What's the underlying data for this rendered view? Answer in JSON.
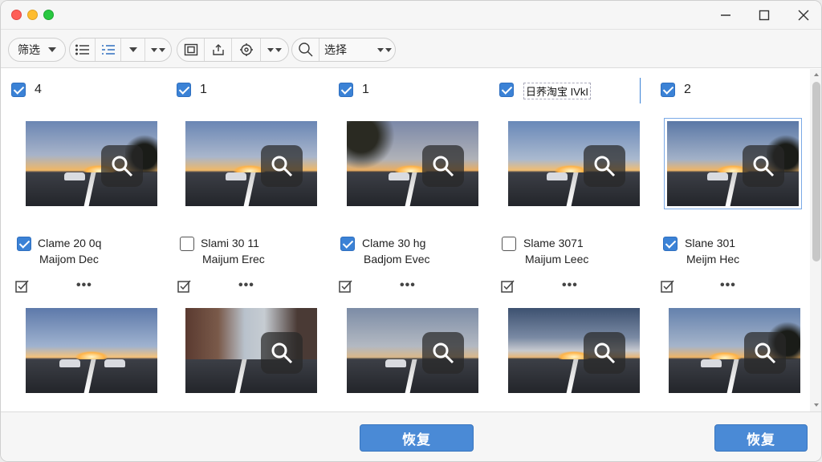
{
  "toolbar": {
    "filter_label": "筛选",
    "select_label": "选择"
  },
  "items": [
    {
      "count": "4",
      "caption_line1": "Clame 20 0q",
      "caption_line2": "Maijom Dec",
      "checked": true
    },
    {
      "count": "1",
      "caption_line1": "Slami 30 11",
      "caption_line2": "Maijum Erec",
      "checked": false
    },
    {
      "count": "1",
      "caption_line1": "Clame 30 hg",
      "caption_line2": "Badjom Evec",
      "checked": true
    },
    {
      "count": "",
      "name_field": "日荞淘宝 IVkI",
      "caption_line1": "Slame 3071",
      "caption_line2": "Maijum Leec",
      "checked": false
    },
    {
      "count": "2",
      "caption_line1": "Slane 301",
      "caption_line2": "Meijm Hec",
      "checked": true
    }
  ],
  "more_label": "•••",
  "bottom": {
    "restore_left": "恢复",
    "restore_right": "恢复"
  },
  "colors": {
    "accent": "#3b82d6",
    "button": "#4a8ad6"
  }
}
